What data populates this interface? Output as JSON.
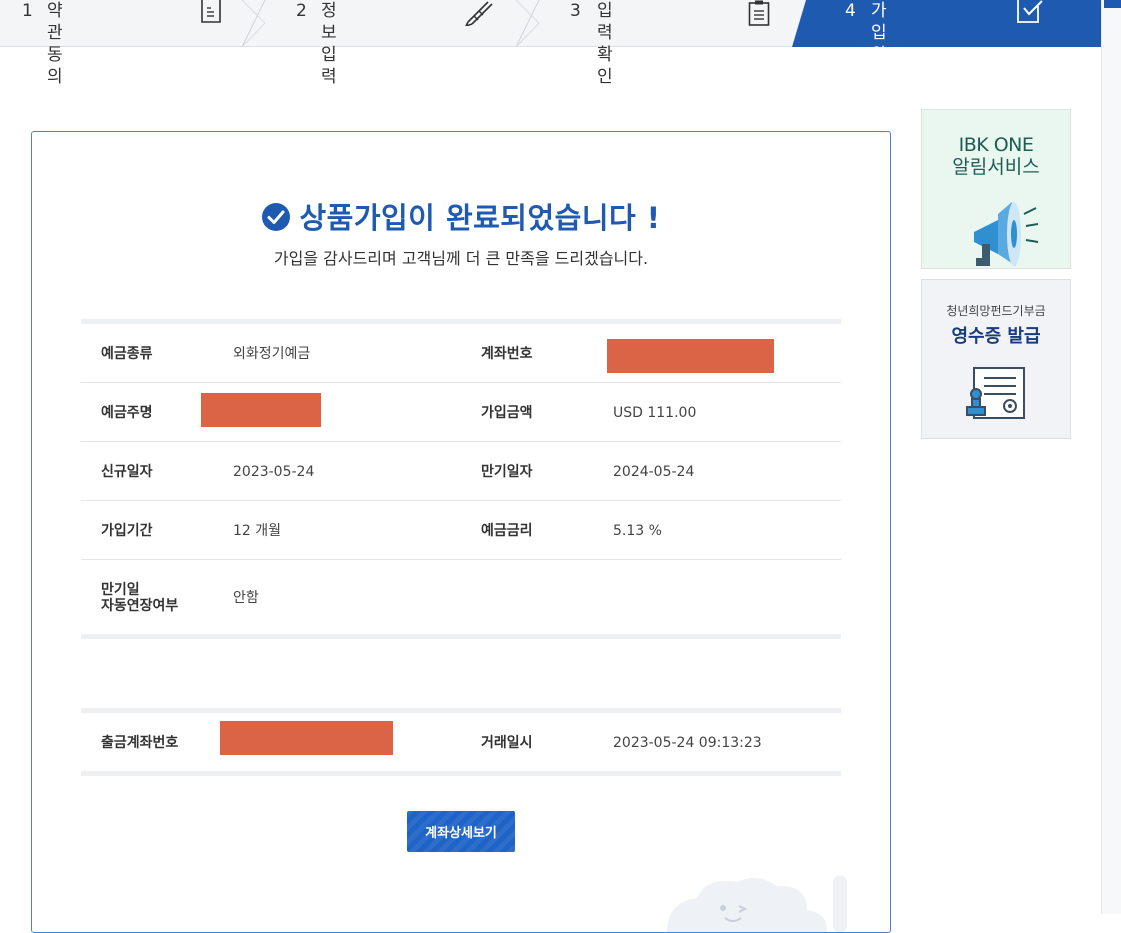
{
  "steps": [
    {
      "num": "1",
      "label": "약관동의"
    },
    {
      "num": "2",
      "label": "정보입력"
    },
    {
      "num": "3",
      "label": "입력확인"
    },
    {
      "num": "4",
      "label": "가입완료"
    }
  ],
  "main": {
    "title": "상품가입이 완료되었습니다 !",
    "subtitle": "가입을 감사드리며 고객님께 더 큰 만족을 드리겠습니다.",
    "details": {
      "deposit_type_label": "예금종류",
      "deposit_type_value": "외화정기예금",
      "account_no_label": "계좌번호",
      "holder_label": "예금주명",
      "amount_label": "가입금액",
      "amount_value": "USD 111.00",
      "open_date_label": "신규일자",
      "open_date_value": "2023-05-24",
      "maturity_date_label": "만기일자",
      "maturity_date_value": "2024-05-24",
      "period_label": "가입기간",
      "period_value": "12 개월",
      "rate_label": "예금금리",
      "rate_value": "5.13 %",
      "auto_extend_label_1": "만기일",
      "auto_extend_label_2": "자동연장여부",
      "auto_extend_value": "안함"
    },
    "transfer": {
      "withdraw_account_label": "출금계좌번호",
      "datetime_label": "거래일시",
      "datetime_value": "2023-05-24 09:13:23"
    },
    "detail_button": "계좌상세보기"
  },
  "banners": {
    "alert_line1": "IBK ONE",
    "alert_line2": "알림서비스",
    "receipt_line1": "청년희망펀드기부금",
    "receipt_line2": "영수증 발급"
  },
  "colors": {
    "brand_blue": "#1e5bb0",
    "masked": "#db6446"
  }
}
